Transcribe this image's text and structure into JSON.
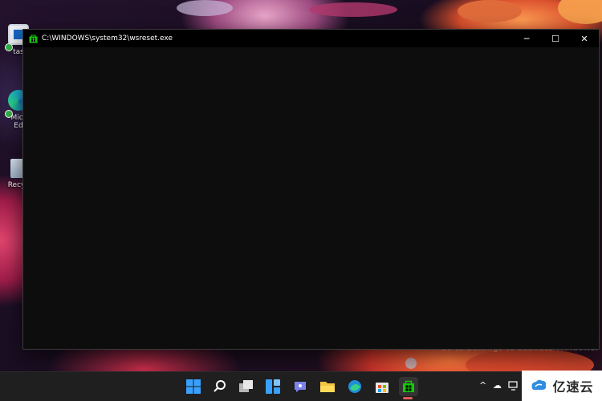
{
  "desktop": {
    "icons": [
      {
        "label": "tas",
        "icon": "task-manager-icon"
      },
      {
        "label": "Micr\nEd",
        "icon": "edge-icon"
      },
      {
        "label": "Recyc",
        "icon": "recycle-bin-icon"
      }
    ],
    "activation_watermark": "Go to Settings to activate Windows."
  },
  "console": {
    "title": "C:\\WINDOWS\\system32\\wsreset.exe",
    "icon": "store-icon",
    "controls": {
      "minimize": "─",
      "maximize": "☐",
      "close": "✕"
    },
    "body_text": ""
  },
  "taskbar": {
    "icons": [
      "start-icon",
      "search-icon",
      "task-view-icon",
      "widgets-icon",
      "teams-chat-icon",
      "file-explorer-icon",
      "edge-icon",
      "microsoft-store-icon",
      "wsreset-icon"
    ],
    "tray": {
      "chevron": "^",
      "cloud": "☁"
    }
  },
  "brand": {
    "text": "亿速云"
  },
  "colors": {
    "accent_green": "#16c60c",
    "active_indicator": "#e05a5a"
  }
}
